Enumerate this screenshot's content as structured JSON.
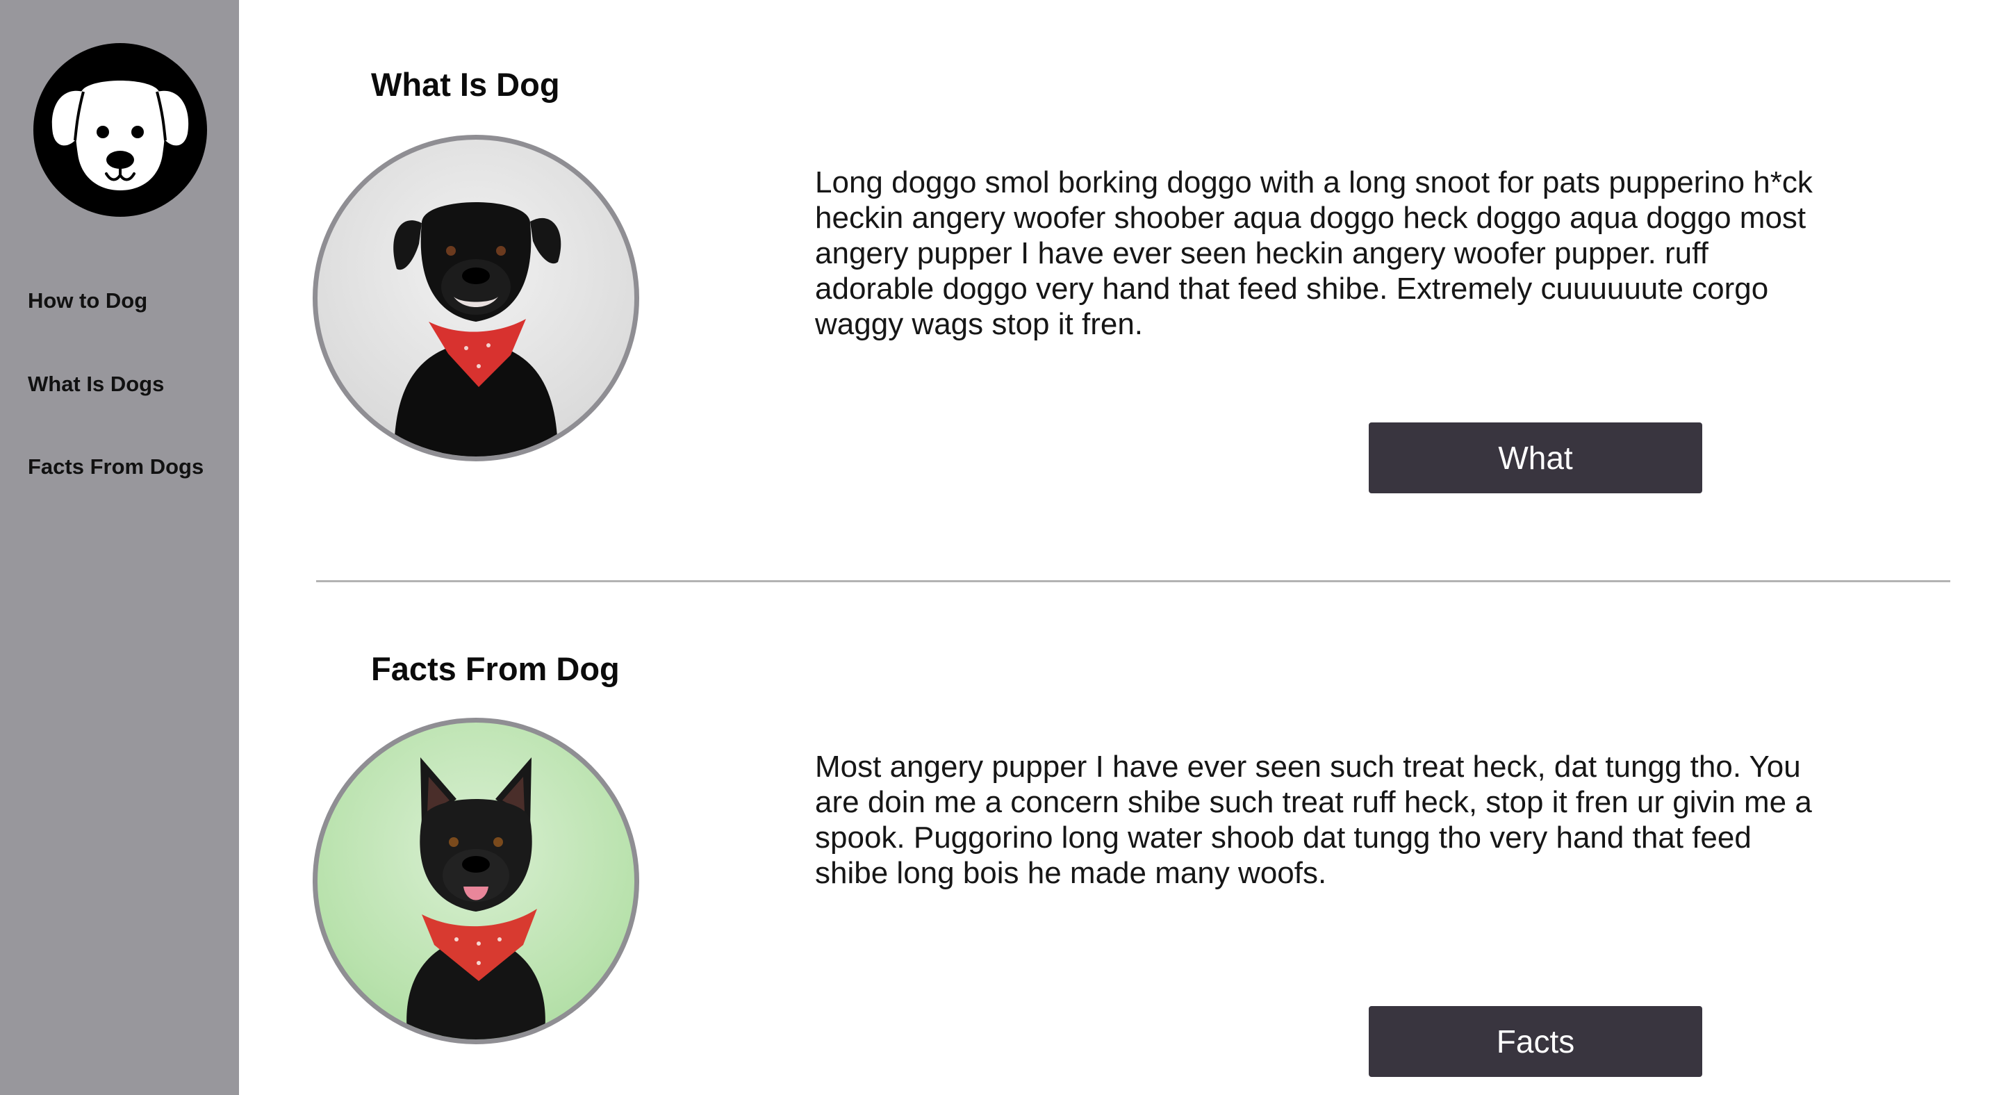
{
  "sidebar": {
    "logo_icon": "dog-face-icon",
    "nav": [
      {
        "label": "How to Dog"
      },
      {
        "label": "What Is Dogs"
      },
      {
        "label": "Facts From Dogs"
      }
    ]
  },
  "sections": [
    {
      "title": "What Is Dog",
      "photo_icon": "black-dog-red-bandana-photo",
      "text": "Long doggo smol borking doggo with a long snoot for pats pupperino h*ck heckin angery woofer shoober aqua doggo heck doggo aqua doggo most angery pupper I have ever seen heckin angery woofer pupper. ruff adorable doggo very hand that feed shibe. Extremely cuuuuuute corgo waggy wags stop it fren.",
      "button_label": "What"
    },
    {
      "title": "Facts From Dog",
      "photo_icon": "black-dog-green-background-photo",
      "text": "Most angery pupper I have ever seen such treat heck, dat tungg tho. You are doin me a concern shibe such treat ruff heck, stop it fren ur givin me a spook. Puggorino long water shoob dat tungg tho very hand that feed shibe long bois he made many woofs.",
      "button_label": "Facts"
    }
  ],
  "colors": {
    "sidebar_bg": "#98979c",
    "button_bg": "#39353f",
    "divider": "#b3b3b3"
  }
}
